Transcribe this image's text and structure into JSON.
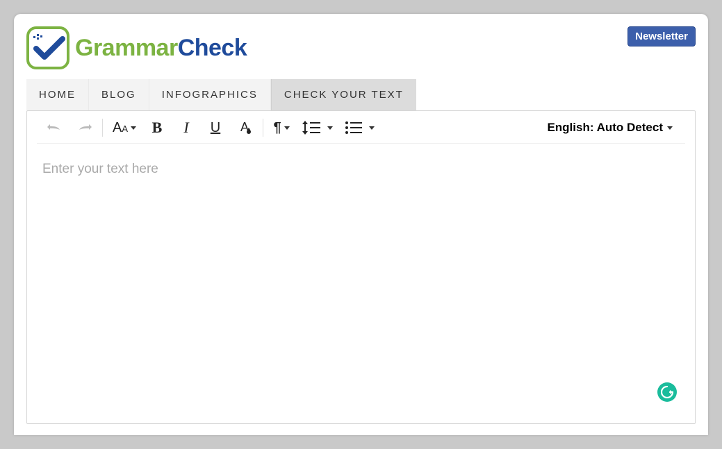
{
  "brand": {
    "word1": "Grammar",
    "word2": "Check"
  },
  "newsletter_label": "Newsletter",
  "nav": {
    "items": [
      {
        "label": "HOME"
      },
      {
        "label": "BLOG"
      },
      {
        "label": "INFOGRAPHICS"
      },
      {
        "label": "CHECK YOUR TEXT",
        "active": true
      }
    ]
  },
  "toolbar": {
    "undo": "undo",
    "redo": "redo",
    "font_reset_big": "A",
    "font_reset_small": "A",
    "bold": "B",
    "italic": "I",
    "underline": "U",
    "remove_format": "A",
    "paragraph": "¶",
    "line_height": "line-height",
    "list": "list"
  },
  "language": {
    "label": "English: Auto Detect"
  },
  "editor": {
    "placeholder": "Enter your text here"
  },
  "grammarly_icon": "G"
}
